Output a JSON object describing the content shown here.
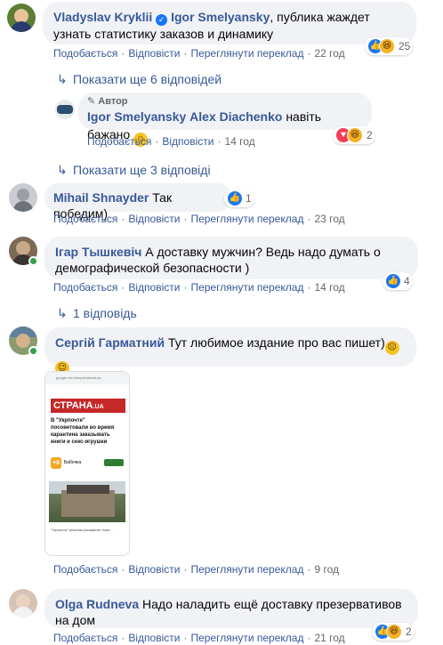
{
  "comments": [
    {
      "name": "Vladyslav Kryklii",
      "tag": "Igor Smelyansky",
      "text": ", публика жаждет узнать статистику заказов и динамику",
      "actions": [
        "Подобається",
        "Відповісти",
        "Переглянути переклад"
      ],
      "time": "22 год",
      "reactions": "25"
    },
    {
      "more": "Показати ще 6 відповідей"
    },
    {
      "author_badge": "Автор",
      "name": "Igor Smelyansky",
      "tag": "Alex Diachenko",
      "text": " навіть бажано",
      "actions": [
        "Подобається",
        "Відповісти"
      ],
      "time": "14 год",
      "reactions": "2"
    },
    {
      "more": "Показати ще 3 відповіді"
    },
    {
      "name": "Mihail Shnayder",
      "text": "Так победим)",
      "reactions": "1",
      "actions": [
        "Подобається",
        "Відповісти",
        "Переглянути переклад"
      ],
      "time": "23 год"
    },
    {
      "name": "Ігар Тышкевіч",
      "text": "А доставку мужчин? Ведь надо думать о демографической безопасности )",
      "actions": [
        "Подобається",
        "Відповісти",
        "Переглянути переклад"
      ],
      "time": "14 год",
      "reactions": "4"
    },
    {
      "more": "1 відповідь"
    },
    {
      "name": "Сергій Гарматний",
      "text": "Тут любимое издание про вас пишет)",
      "actions": [
        "Подобається",
        "Відповісти",
        "Переглянути переклад"
      ],
      "time": "9 год"
    },
    {
      "name": "Olga Rudneva",
      "text": "Надо наладить ещё доставку презервативов на дом",
      "actions": [
        "Подобається",
        "Відповісти",
        "Переглянути переклад"
      ],
      "time": "21 год",
      "reactions": "2"
    }
  ],
  "screenshot": {
    "url": "google.com/amp/s/strana.ua",
    "logo": "СТРАНА",
    "logo_suffix": ".UA",
    "headline_prefix": "В \"Укрпочте\"",
    "headline": "посоветовали во время карантина заказывать книги и секс-игрушки",
    "app_badge": "+8",
    "app_name": "Бабочка",
    "caption": "\"Укрпочта\" решила расширить поле... "
  },
  "colors": {
    "link": "#385898",
    "bubble": "#f0f2f5",
    "meta": "#65676b",
    "like": "#1877f2",
    "online": "#31a24c"
  }
}
